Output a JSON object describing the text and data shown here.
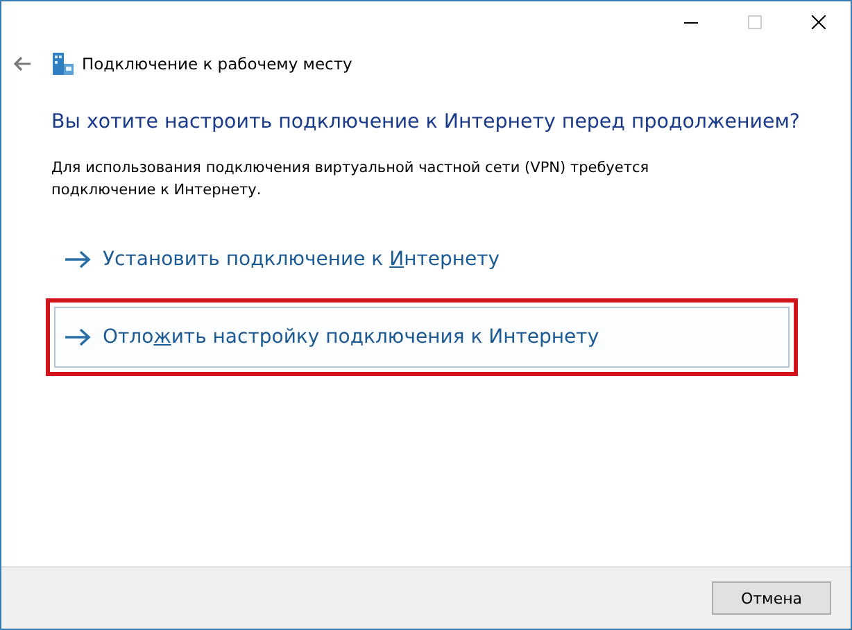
{
  "window": {
    "title": "Подключение к рабочему месту"
  },
  "heading": "Вы хотите настроить подключение к Интернету перед продолжением?",
  "description": "Для использования подключения виртуальной частной сети (VPN) требуется подключение к Интернету.",
  "options": [
    {
      "label_before": "Установить подключение к ",
      "access_key": "И",
      "label_after": "нтернету",
      "selected": false,
      "highlighted": false
    },
    {
      "label_before": "Отло",
      "access_key": "ж",
      "label_after": "ить настройку подключения к Интернету",
      "selected": true,
      "highlighted": true
    }
  ],
  "buttons": [
    {
      "label": "Отмена"
    }
  ]
}
